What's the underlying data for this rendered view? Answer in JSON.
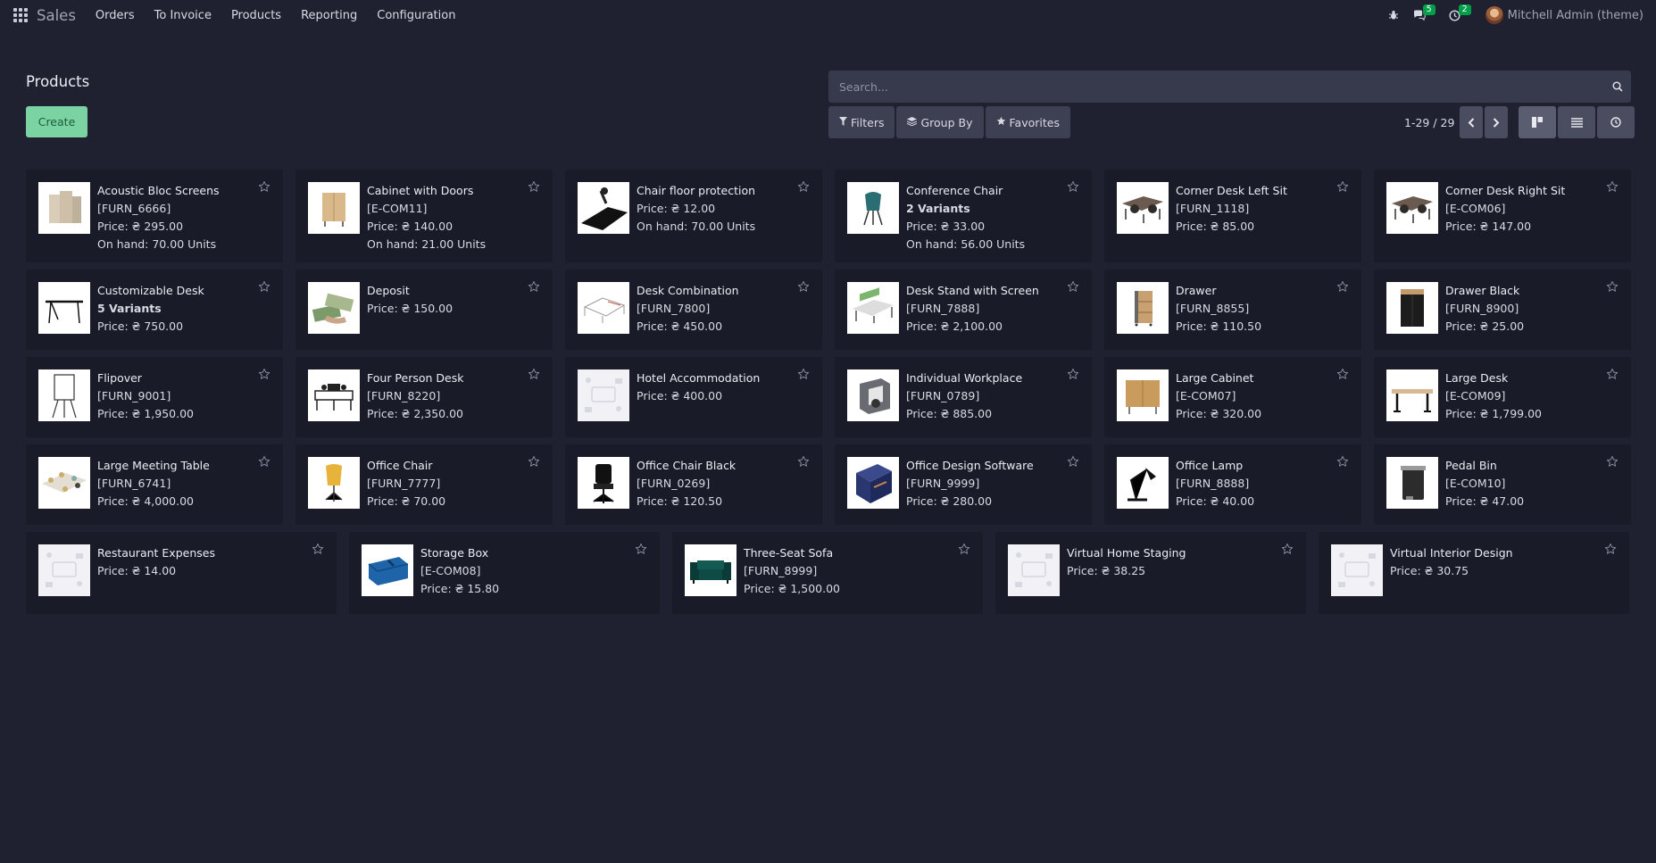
{
  "navbar": {
    "brand": "Sales",
    "menu": [
      "Orders",
      "To Invoice",
      "Products",
      "Reporting",
      "Configuration"
    ],
    "messages_count": "5",
    "activities_count": "2",
    "user_name": "Mitchell Admin (theme)"
  },
  "control_panel": {
    "title": "Products",
    "create_label": "Create",
    "search_placeholder": "Search...",
    "filters_label": "Filters",
    "group_by_label": "Group By",
    "favorites_label": "Favorites",
    "pager_value": "1-29 / 29"
  },
  "colors": {
    "background": "#1f2130",
    "card": "#191b28",
    "create_button": "#7bd3a4",
    "badge": "#00a04a"
  },
  "products": [
    {
      "name": "Acoustic Bloc Screens",
      "ref": "[FURN_6666]",
      "price": "Price: ₴ 295.00",
      "onhand": "On hand: 70.00 Units",
      "icon": "screens-image"
    },
    {
      "name": "Cabinet with Doors",
      "ref": "[E-COM11]",
      "price": "Price: ₴ 140.00",
      "onhand": "On hand: 21.00 Units",
      "icon": "cabinet-image"
    },
    {
      "name": "Chair floor protection",
      "price": "Price: ₴ 12.00",
      "onhand": "On hand: 70.00 Units",
      "icon": "floor-mat-image"
    },
    {
      "name": "Conference Chair",
      "variants": "2 Variants",
      "price": "Price: ₴ 33.00",
      "onhand": "On hand: 56.00 Units",
      "icon": "chair-image"
    },
    {
      "name": "Corner Desk Left Sit",
      "ref": "[FURN_1118]",
      "price": "Price: ₴ 85.00",
      "icon": "corner-desk-image"
    },
    {
      "name": "Corner Desk Right Sit",
      "ref": "[E-COM06]",
      "price": "Price: ₴ 147.00",
      "icon": "corner-desk-image"
    },
    {
      "name": "Customizable Desk",
      "variants": "5 Variants",
      "price": "Price: ₴ 750.00",
      "icon": "desk-image"
    },
    {
      "name": "Deposit",
      "price": "Price: ₴ 150.00",
      "icon": "money-image"
    },
    {
      "name": "Desk Combination",
      "ref": "[FURN_7800]",
      "price": "Price: ₴ 450.00",
      "icon": "desk-combo-image"
    },
    {
      "name": "Desk Stand with Screen",
      "ref": "[FURN_7888]",
      "price": "Price: ₴ 2,100.00",
      "icon": "desk-stand-image"
    },
    {
      "name": "Drawer",
      "ref": "[FURN_8855]",
      "price": "Price: ₴ 110.50",
      "icon": "drawer-image"
    },
    {
      "name": "Drawer Black",
      "ref": "[FURN_8900]",
      "price": "Price: ₴ 25.00",
      "icon": "drawer-black-image"
    },
    {
      "name": "Flipover",
      "ref": "[FURN_9001]",
      "price": "Price: ₴ 1,950.00",
      "icon": "flipover-image"
    },
    {
      "name": "Four Person Desk",
      "ref": "[FURN_8220]",
      "price": "Price: ₴ 2,350.00",
      "icon": "four-desk-image"
    },
    {
      "name": "Hotel Accommodation",
      "price": "Price: ₴ 400.00",
      "icon": "placeholder-image"
    },
    {
      "name": "Individual Workplace",
      "ref": "[FURN_0789]",
      "price": "Price: ₴ 885.00",
      "icon": "workplace-image"
    },
    {
      "name": "Large Cabinet",
      "ref": "[E-COM07]",
      "price": "Price: ₴ 320.00",
      "icon": "large-cabinet-image"
    },
    {
      "name": "Large Desk",
      "ref": "[E-COM09]",
      "price": "Price: ₴ 1,799.00",
      "icon": "large-desk-image"
    },
    {
      "name": "Large Meeting Table",
      "ref": "[FURN_6741]",
      "price": "Price: ₴ 4,000.00",
      "icon": "meeting-table-image"
    },
    {
      "name": "Office Chair",
      "ref": "[FURN_7777]",
      "price": "Price: ₴ 70.00",
      "icon": "office-chair-image"
    },
    {
      "name": "Office Chair Black",
      "ref": "[FURN_0269]",
      "price": "Price: ₴ 120.50",
      "icon": "office-chair-black-image"
    },
    {
      "name": "Office Design Software",
      "ref": "[FURN_9999]",
      "price": "Price: ₴ 280.00",
      "icon": "software-box-image"
    },
    {
      "name": "Office Lamp",
      "ref": "[FURN_8888]",
      "price": "Price: ₴ 40.00",
      "icon": "lamp-image"
    },
    {
      "name": "Pedal Bin",
      "ref": "[E-COM10]",
      "price": "Price: ₴ 47.00",
      "icon": "bin-image"
    },
    {
      "name": "Restaurant Expenses",
      "price": "Price: ₴ 14.00",
      "icon": "placeholder-image"
    },
    {
      "name": "Storage Box",
      "ref": "[E-COM08]",
      "price": "Price: ₴ 15.80",
      "icon": "storage-box-image"
    },
    {
      "name": "Three-Seat Sofa",
      "ref": "[FURN_8999]",
      "price": "Price: ₴ 1,500.00",
      "icon": "sofa-image"
    },
    {
      "name": "Virtual Home Staging",
      "price": "Price: ₴ 38.25",
      "icon": "placeholder-image"
    },
    {
      "name": "Virtual Interior Design",
      "price": "Price: ₴ 30.75",
      "icon": "placeholder-image"
    }
  ]
}
